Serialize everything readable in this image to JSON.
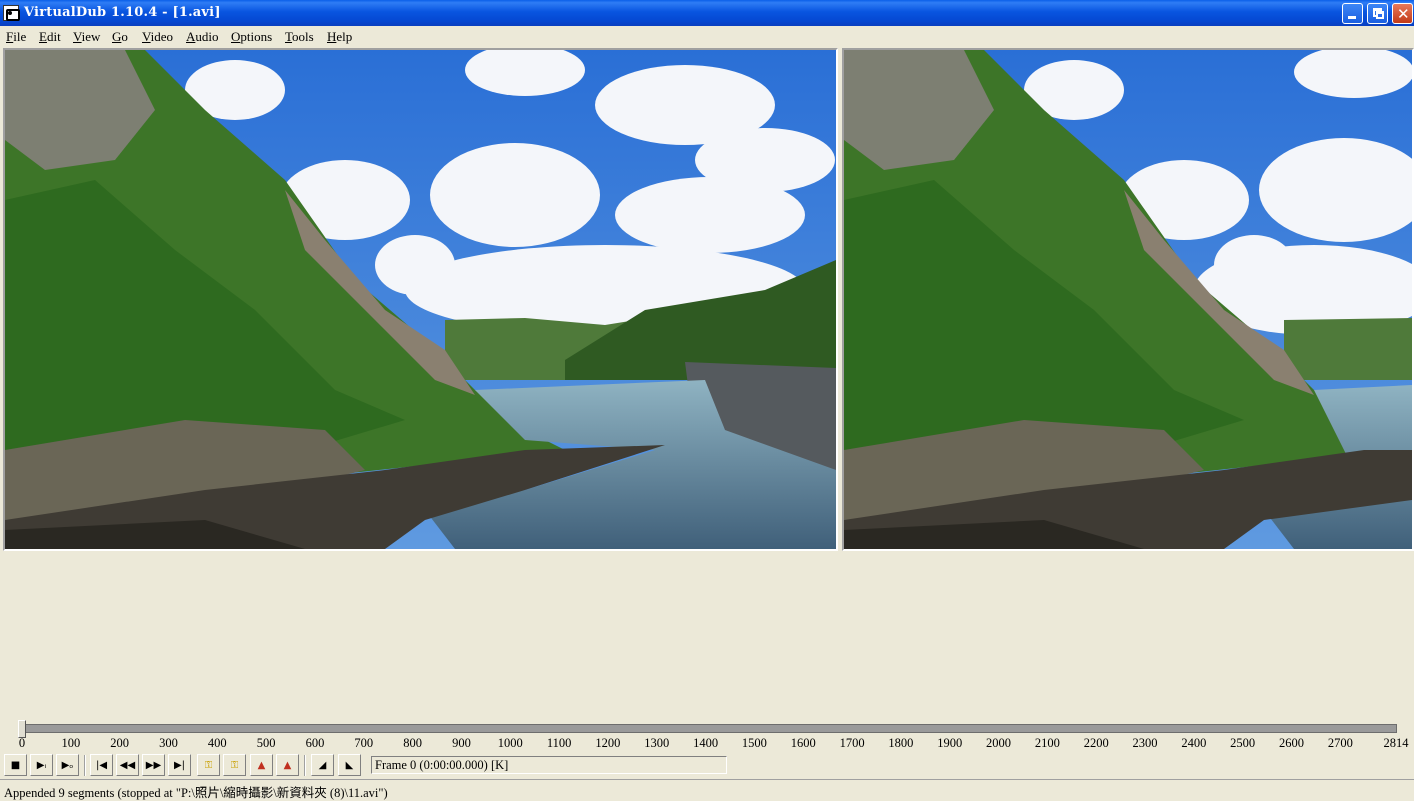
{
  "window": {
    "title": "VirtualDub 1.10.4 - [1.avi]"
  },
  "menu": [
    {
      "label": "File",
      "key": "F",
      "rest": "ile"
    },
    {
      "label": "Edit",
      "key": "E",
      "rest": "dit"
    },
    {
      "label": "View",
      "key": "V",
      "rest": "iew"
    },
    {
      "label": "Go",
      "key": "G",
      "rest": "o"
    },
    {
      "label": "Video",
      "key": "V",
      "rest": "ideo"
    },
    {
      "label": "Audio",
      "key": "A",
      "rest": "udio"
    },
    {
      "label": "Options",
      "key": "O",
      "rest": "ptions"
    },
    {
      "label": "Tools",
      "key": "T",
      "rest": "ools"
    },
    {
      "label": "Help",
      "key": "H",
      "rest": "elp"
    }
  ],
  "timeline": {
    "min": 0,
    "max": 2814,
    "position": 0,
    "tick_labels": [
      "0",
      "100",
      "200",
      "300",
      "400",
      "500",
      "600",
      "700",
      "800",
      "900",
      "1000",
      "1100",
      "1200",
      "1300",
      "1400",
      "1500",
      "1600",
      "1700",
      "1800",
      "1900",
      "2000",
      "2100",
      "2200",
      "2300",
      "2400",
      "2500",
      "2600",
      "2700",
      "2814"
    ]
  },
  "toolbar": {
    "frame_readout": "Frame 0 (0:00:00.000) [K]"
  },
  "status": {
    "text": "Appended 9 segments (stopped at \"P:\\照片\\縮時攝影\\新資料夾 (8)\\11.avi\")"
  },
  "colors": {
    "titlebar": "#0a56e0",
    "chrome": "#ece9d8",
    "sky": "#2d74d8",
    "foliage": "#2f6a1e",
    "water": "#6d8fa0"
  }
}
